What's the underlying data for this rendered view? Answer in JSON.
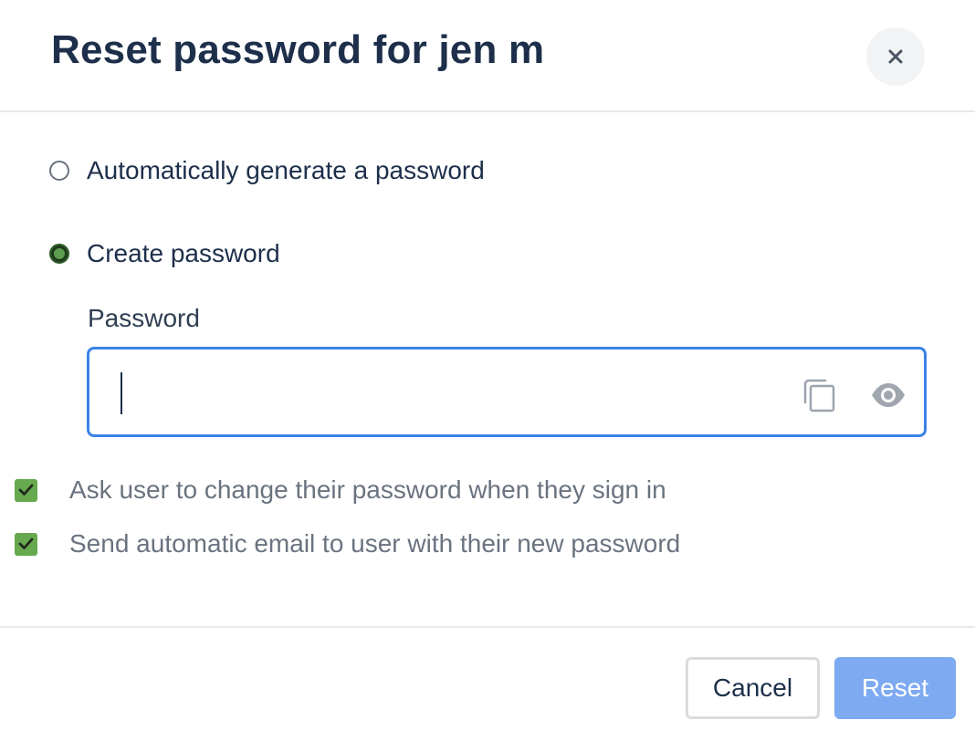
{
  "dialog": {
    "title": "Reset password for jen m",
    "close_icon": "close-icon"
  },
  "options": [
    {
      "label": "Automatically generate a password",
      "selected": false
    },
    {
      "label": "Create password",
      "selected": true
    }
  ],
  "password": {
    "label": "Password",
    "value": "",
    "placeholder": "",
    "copy_icon": "copy-icon",
    "show_icon": "eye-icon"
  },
  "checkboxes": [
    {
      "label": "Ask user to change their password when they sign in",
      "checked": true
    },
    {
      "label": "Send automatic email to user with their new password",
      "checked": true
    }
  ],
  "footer": {
    "cancel_label": "Cancel",
    "reset_label": "Reset"
  },
  "colors": {
    "accent_blue": "#3b82e6",
    "reset_button": "#7eaaf2",
    "check_green": "#66a94f",
    "title_navy": "#1d2f4a"
  }
}
